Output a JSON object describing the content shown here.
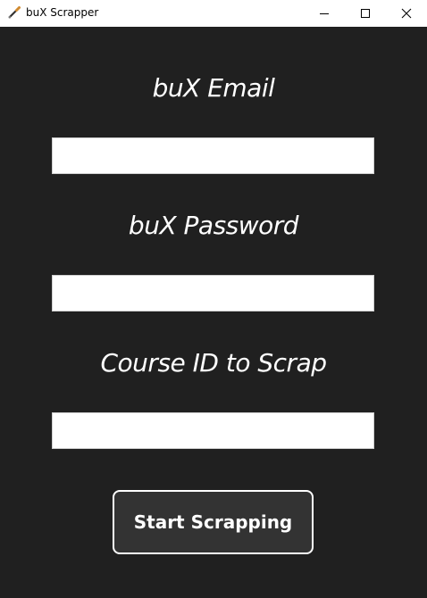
{
  "window": {
    "title": "buX Scrapper",
    "icon": "pen-brush-icon",
    "controls": {
      "minimize": "minimize-icon",
      "maximize": "maximize-icon",
      "close": "close-icon"
    }
  },
  "form": {
    "email_label": "buX Email",
    "email_value": "",
    "password_label": "buX Password",
    "password_value": "",
    "course_label": "Course ID to Scrap",
    "course_value": "",
    "submit_label": "Start Scrapping"
  },
  "colors": {
    "background": "#202020",
    "button_bg": "#333333",
    "text": "#ffffff"
  }
}
